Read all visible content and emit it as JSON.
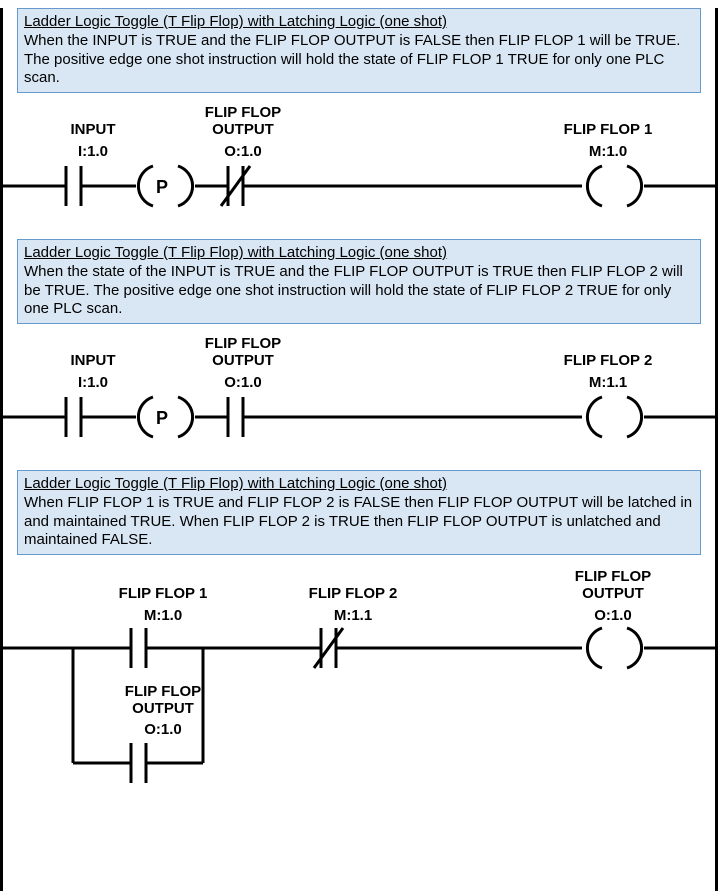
{
  "rung1": {
    "title": "Ladder Logic Toggle (T Flip Flop) with Latching Logic (one shot)",
    "body": "When the INPUT is TRUE and the  FLIP FLOP OUTPUT is FALSE then FLIP FLOP 1 will be TRUE. The positive edge one shot instruction will hold the state of FLIP FLOP 1 TRUE for only one PLC scan.",
    "el1_tag": "INPUT",
    "el1_addr": "I:1.0",
    "el2_tag": "FLIP FLOP\nOUTPUT",
    "el2_addr": "O:1.0",
    "out_tag": "FLIP FLOP 1",
    "out_addr": "M:1.0",
    "p_letter": "P"
  },
  "rung2": {
    "title": "Ladder Logic Toggle (T Flip Flop) with Latching Logic (one shot)",
    "body": "When the state of the INPUT is TRUE and the FLIP FLOP OUTPUT is TRUE then FLIP FLOP 2 will be TRUE. The positive edge one shot instruction will hold the state of FLIP FLOP 2 TRUE for only one PLC scan.",
    "el1_tag": "INPUT",
    "el1_addr": "I:1.0",
    "el2_tag": "FLIP FLOP\nOUTPUT",
    "el2_addr": "O:1.0",
    "out_tag": "FLIP FLOP 2",
    "out_addr": "M:1.1",
    "p_letter": "P"
  },
  "rung3": {
    "title": "Ladder Logic Toggle (T Flip Flop) with Latching Logic (one shot)",
    "body": "When FLIP FLOP 1 is TRUE and FLIP FLOP 2 is FALSE then FLIP FLOP OUTPUT will be latched in and maintained TRUE. When FLIP FLOP 2 is TRUE then FLIP FLOP OUTPUT is unlatched and maintained FALSE.",
    "el1_tag": "FLIP FLOP 1",
    "el1_addr": "M:1.0",
    "el2_tag": "FLIP FLOP 2",
    "el2_addr": "M:1.1",
    "out_tag": "FLIP FLOP\nOUTPUT",
    "out_addr": "O:1.0",
    "branch_tag": "FLIP FLOP\nOUTPUT",
    "branch_addr": "O:1.0"
  }
}
